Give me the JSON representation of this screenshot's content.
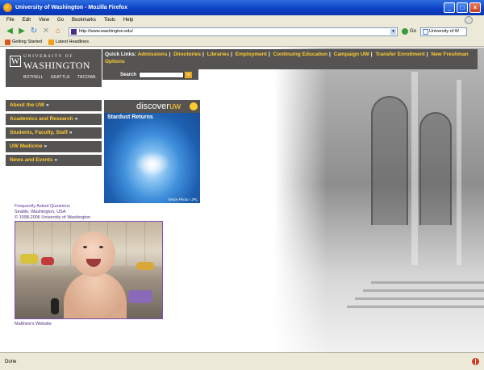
{
  "window": {
    "title": "University of Washington - Mozilla Firefox",
    "minimize": "_",
    "maximize": "□",
    "close": "×"
  },
  "menu": [
    "File",
    "Edit",
    "View",
    "Go",
    "Bookmarks",
    "Tools",
    "Help"
  ],
  "toolbar": {
    "url": "http://www.washington.edu/",
    "go_label": "Go",
    "search_value": "University of W"
  },
  "bookmarks": [
    "Getting Started",
    "Latest Headlines"
  ],
  "logo": {
    "line1": "UNIVERSITY OF",
    "line2": "WASHINGTON",
    "campuses": [
      "BOTHELL",
      "SEATTLE",
      "TACOMA"
    ]
  },
  "quicklinks": {
    "label": "Quick Links:",
    "links": [
      "Admissions",
      "Directories",
      "Libraries",
      "Employment",
      "Continuing Education",
      "Campaign UW",
      "Transfer Enrollment",
      "New Freshman Options"
    ]
  },
  "search": {
    "label": "Search",
    "go": "»"
  },
  "leftnav": [
    "About the UW",
    "Academics and Research",
    "Students, Faculty, Staff",
    "UW Medicine",
    "News and Events"
  ],
  "discover": {
    "head_prefix": "discover",
    "head_suffix": "uw",
    "feature_title": "Stardust Returns",
    "credit": "NASA Photo / JPL"
  },
  "footer": {
    "faq": "Frequently Asked Questions",
    "location": "Seattle, Washington, USA",
    "copyright": "© 1998-2006 University of Washington"
  },
  "caption": "Matthew's Website",
  "status": {
    "text": "Done"
  }
}
